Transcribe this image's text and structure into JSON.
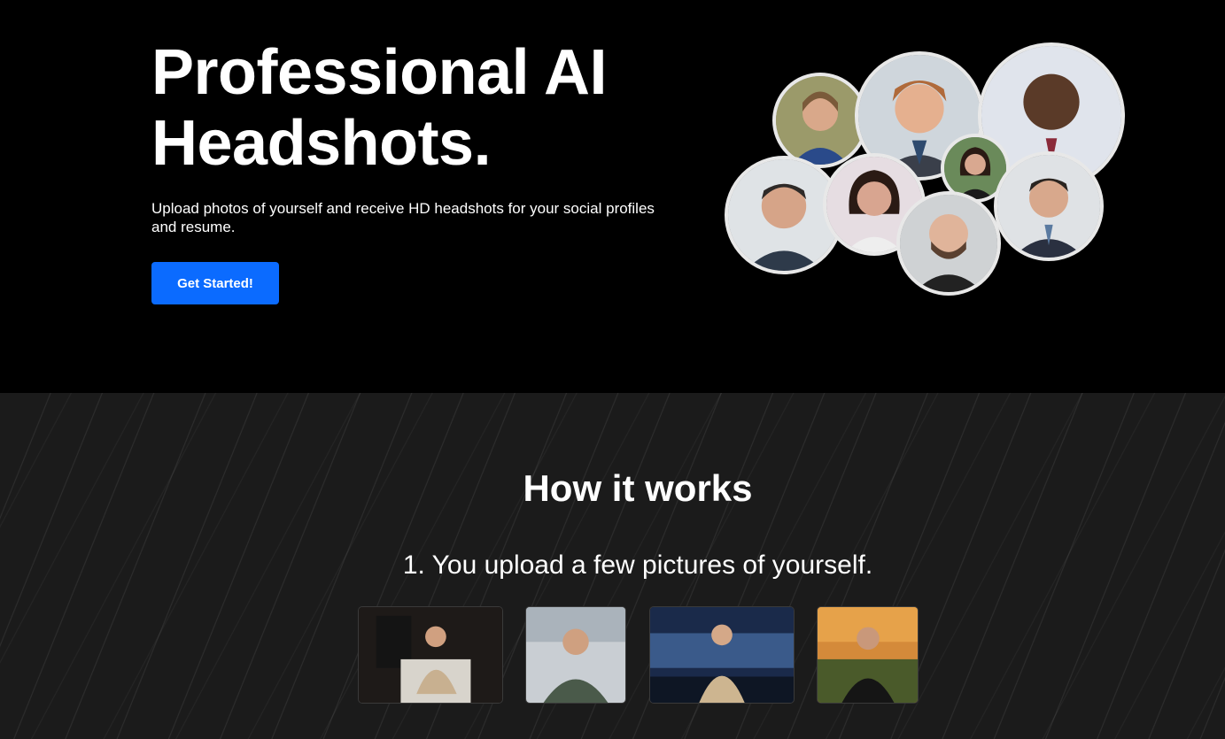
{
  "hero": {
    "title_line1": "Professional AI",
    "title_line2": "Headshots.",
    "subtitle": "Upload photos of yourself and receive HD headshots for your social profiles and resume.",
    "cta_label": "Get Started!"
  },
  "how": {
    "title": "How it works",
    "step1": "1. You upload a few pictures of yourself."
  },
  "colors": {
    "accent": "#0b6bff",
    "hero_bg": "#000000",
    "section_bg": "#1b1b1b"
  }
}
